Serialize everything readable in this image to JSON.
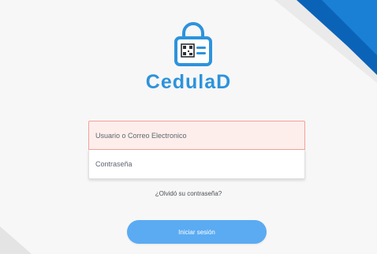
{
  "app": {
    "name": "CedulaD",
    "logo_icon": "id-card-lock-icon"
  },
  "form": {
    "username_placeholder": "Usuario o Correo Electronico",
    "password_placeholder": "Contraseña",
    "forgot_link": "¿Olvidó su contraseña?",
    "login_button": "Iniciar sesión"
  },
  "colors": {
    "brand": "#2d93dc",
    "corner_dark": "#0a6ec7",
    "button": "#5aabf2",
    "error_border": "#f2a29b",
    "error_bg": "#fdeeec"
  }
}
